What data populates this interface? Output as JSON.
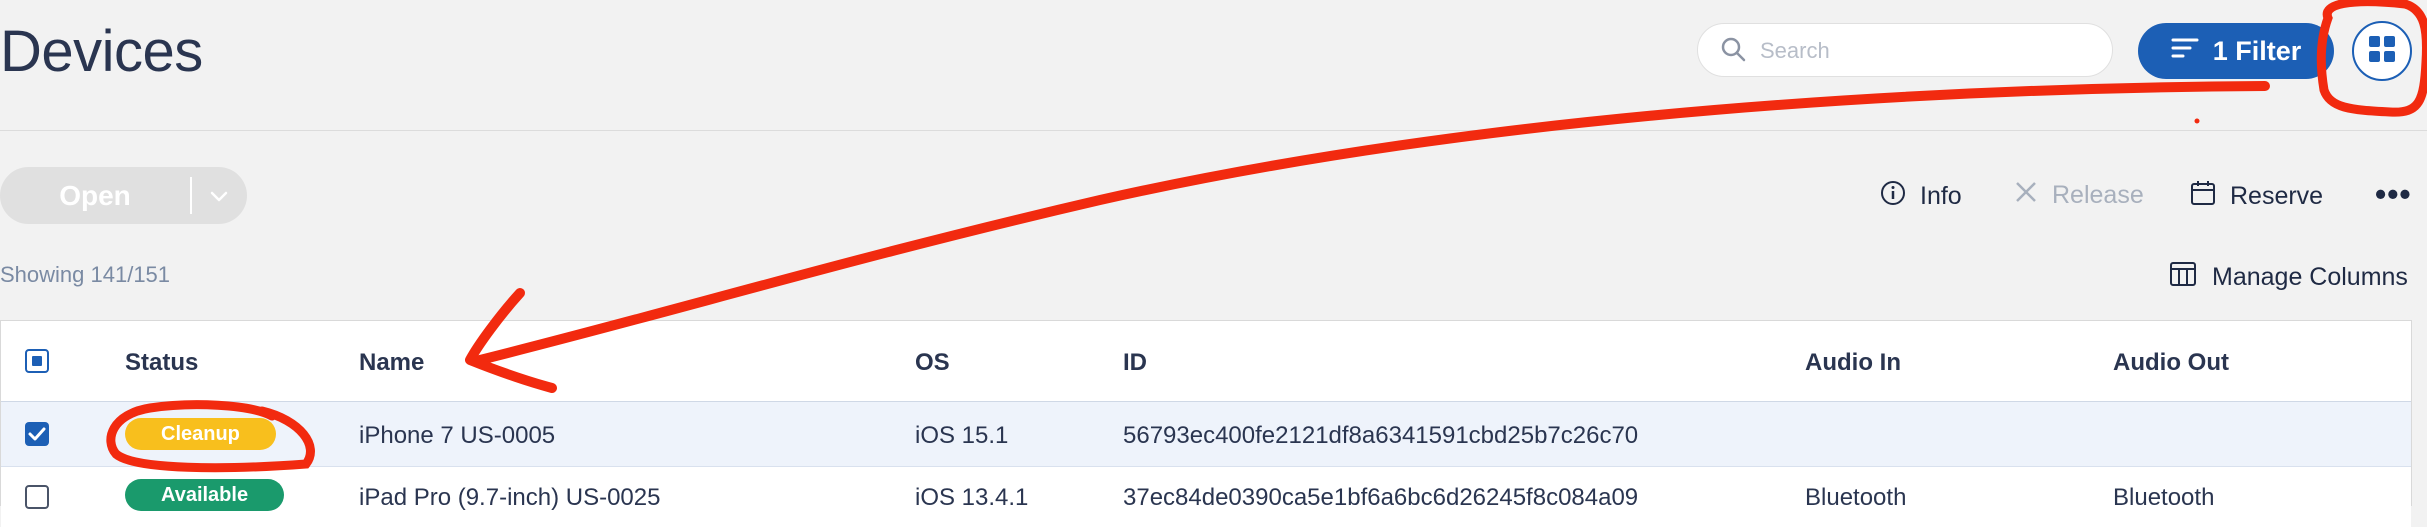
{
  "page": {
    "title": "Devices"
  },
  "header": {
    "search_placeholder": "Search",
    "filter_label": "1 Filter"
  },
  "toolbar": {
    "open_label": "Open",
    "info_label": "Info",
    "release_label": "Release",
    "reserve_label": "Reserve",
    "more_label": "•••"
  },
  "list": {
    "showing_text": "Showing 141/151",
    "manage_columns_label": "Manage Columns"
  },
  "table": {
    "headers": [
      "Status",
      "Name",
      "OS",
      "ID",
      "Audio In",
      "Audio Out"
    ],
    "rows": [
      {
        "selected": true,
        "status": "Cleanup",
        "status_color": "#f8bf1d",
        "name": "iPhone 7 US-0005",
        "os": "iOS 15.1",
        "id": "56793ec400fe2121df8a6341591cbd25b7c26c70",
        "audio_in": "",
        "audio_out": ""
      },
      {
        "selected": false,
        "status": "Available",
        "status_color": "#1a9a6c",
        "name": "iPad Pro (9.7-inch) US-0025",
        "os": "iOS 13.4.1",
        "id": "37ec84de0390ca5e1bf6a6bc6d26245f8c084a09",
        "audio_in": "Bluetooth",
        "audio_out": "Bluetooth"
      }
    ]
  },
  "colors": {
    "accent": "#1c5fb5",
    "annotation": "#f22a0f",
    "cleanup": "#f8bf1d",
    "available": "#1a9a6c"
  },
  "icons": [
    "search-icon",
    "filter-icon",
    "grid-view-icon",
    "chevron-down-icon",
    "info-icon",
    "close-icon",
    "calendar-icon",
    "columns-icon",
    "checkbox-icon"
  ]
}
